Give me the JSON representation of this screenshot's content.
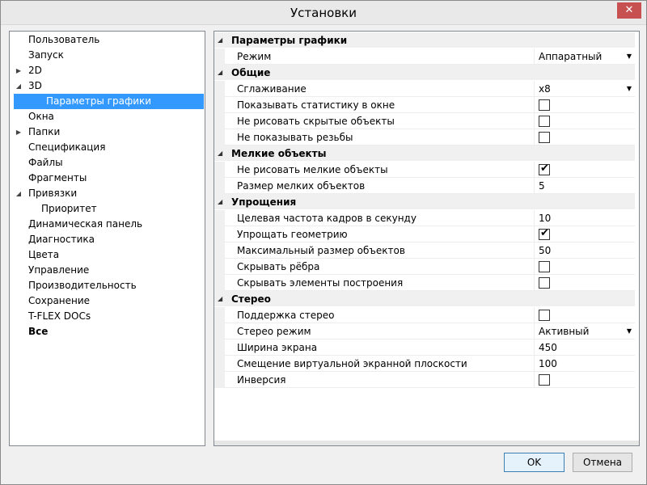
{
  "window": {
    "title": "Установки"
  },
  "tree": {
    "items": [
      {
        "label": "Пользователь",
        "indent": 0,
        "arrow": ""
      },
      {
        "label": "Запуск",
        "indent": 0,
        "arrow": ""
      },
      {
        "label": "2D",
        "indent": 0,
        "arrow": "▶"
      },
      {
        "label": "3D",
        "indent": 0,
        "arrow": "◢"
      },
      {
        "label": "Параметры графики",
        "indent": 1,
        "arrow": "",
        "selected": true
      },
      {
        "label": "Окна",
        "indent": 0,
        "arrow": ""
      },
      {
        "label": "Папки",
        "indent": 0,
        "arrow": "▶"
      },
      {
        "label": "Спецификация",
        "indent": 0,
        "arrow": ""
      },
      {
        "label": "Файлы",
        "indent": 0,
        "arrow": ""
      },
      {
        "label": "Фрагменты",
        "indent": 0,
        "arrow": ""
      },
      {
        "label": "Привязки",
        "indent": 0,
        "arrow": "◢"
      },
      {
        "label": "Приоритет",
        "indent": 1,
        "arrow": ""
      },
      {
        "label": "Динамическая панель",
        "indent": 0,
        "arrow": ""
      },
      {
        "label": "Диагностика",
        "indent": 0,
        "arrow": ""
      },
      {
        "label": "Цвета",
        "indent": 0,
        "arrow": ""
      },
      {
        "label": "Управление",
        "indent": 0,
        "arrow": ""
      },
      {
        "label": "Производительность",
        "indent": 0,
        "arrow": ""
      },
      {
        "label": "Сохранение",
        "indent": 0,
        "arrow": ""
      },
      {
        "label": "T-FLEX DOCs",
        "indent": 0,
        "arrow": ""
      },
      {
        "label": "Все",
        "indent": 0,
        "arrow": "",
        "bold": true
      }
    ]
  },
  "grid": {
    "rows": [
      {
        "type": "category",
        "label": "Параметры графики"
      },
      {
        "type": "prop",
        "name": "Режим",
        "kind": "dropdown",
        "value": "Аппаратный"
      },
      {
        "type": "category",
        "label": "Общие"
      },
      {
        "type": "prop",
        "name": "Сглаживание",
        "kind": "dropdown",
        "value": "x8"
      },
      {
        "type": "prop",
        "name": "Показывать статистику в окне",
        "kind": "checkbox",
        "checked": false
      },
      {
        "type": "prop",
        "name": "Не рисовать скрытые объекты",
        "kind": "checkbox",
        "checked": false
      },
      {
        "type": "prop",
        "name": "Не показывать резьбы",
        "kind": "checkbox",
        "checked": false
      },
      {
        "type": "category",
        "label": "Мелкие объекты"
      },
      {
        "type": "prop",
        "name": "Не рисовать мелкие объекты",
        "kind": "checkbox",
        "checked": true
      },
      {
        "type": "prop",
        "name": "Размер мелких объектов",
        "kind": "text",
        "value": "5"
      },
      {
        "type": "category",
        "label": "Упрощения"
      },
      {
        "type": "prop",
        "name": "Целевая частота кадров в секунду",
        "kind": "text",
        "value": "10"
      },
      {
        "type": "prop",
        "name": "Упрощать геометрию",
        "kind": "checkbox",
        "checked": true
      },
      {
        "type": "prop",
        "name": "Максимальный размер объектов",
        "kind": "text",
        "value": "50"
      },
      {
        "type": "prop",
        "name": "Скрывать рёбра",
        "kind": "checkbox",
        "checked": false
      },
      {
        "type": "prop",
        "name": "Скрывать элементы построения",
        "kind": "checkbox",
        "checked": false
      },
      {
        "type": "category",
        "label": "Стерео"
      },
      {
        "type": "prop",
        "name": "Поддержка стерео",
        "kind": "checkbox",
        "checked": false
      },
      {
        "type": "prop",
        "name": "Стерео режим",
        "kind": "dropdown",
        "value": "Активный"
      },
      {
        "type": "prop",
        "name": "Ширина экрана",
        "kind": "text",
        "value": "450"
      },
      {
        "type": "prop",
        "name": "Смещение виртуальной экранной плоскости",
        "kind": "text",
        "value": "100"
      },
      {
        "type": "prop",
        "name": "Инверсия",
        "kind": "checkbox",
        "checked": false
      }
    ]
  },
  "buttons": {
    "ok": "OK",
    "cancel": "Отмена"
  },
  "icons": {
    "close": "close-icon",
    "collapse": "collapse-triangle-icon",
    "dropdown": "chevron-down-icon",
    "check": "checkmark-icon"
  }
}
